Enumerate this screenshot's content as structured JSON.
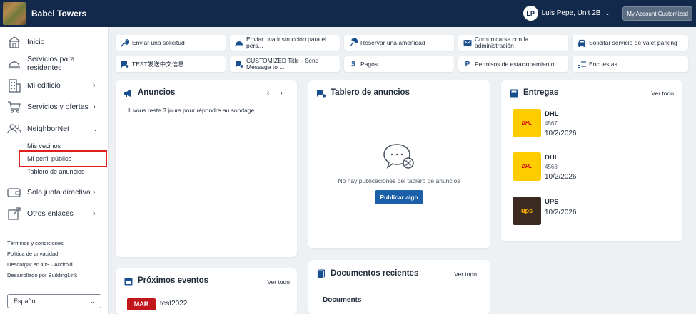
{
  "header": {
    "building_name": "Babel Towers",
    "user_initials": "LP",
    "user_name": "Luis Pepe, Unit 2B",
    "account_button": "My Account Customized"
  },
  "sidebar": {
    "items": [
      {
        "label": "Inicio",
        "icon": "home-icon"
      },
      {
        "label": "Servicios para residentes",
        "icon": "concierge-bell-icon"
      },
      {
        "label": "Mi edificio",
        "icon": "building-icon"
      },
      {
        "label": "Servicios y ofertas",
        "icon": "shopping-cart-icon"
      },
      {
        "label": "NeighborNet",
        "icon": "users-icon"
      },
      {
        "label": "Solo junta directiva",
        "icon": "wallet-icon"
      },
      {
        "label": "Otros enlaces",
        "icon": "external-link-icon"
      }
    ],
    "sub_items": [
      "Mis vecinos",
      "Mi perfil público",
      "Tablero de anuncios"
    ],
    "footer_links": [
      "Términos y condiciones",
      "Política de privacidad",
      "Descargar en iOS · Android",
      "Desarrollado por BuildingLink"
    ],
    "language": "Español"
  },
  "quick_actions": [
    {
      "label": "Enviar una solicitud",
      "icon": "wrench-icon"
    },
    {
      "label": "Enviar una instrucción para el pers...",
      "icon": "concierge-bell-icon"
    },
    {
      "label": "Reservar una amenidad",
      "icon": "amenity-icon"
    },
    {
      "label": "Comunicarse con la administración",
      "icon": "envelope-icon"
    },
    {
      "label": "Solicitar servicio de valet parking",
      "icon": "car-icon"
    },
    {
      "label": "TEST发送中文信息",
      "icon": "chat-add-icon"
    },
    {
      "label": "CUSTOMIZED Title - Send Message to ...",
      "icon": "chat-add-icon"
    },
    {
      "label": "Pagos",
      "icon": "dollar-icon"
    },
    {
      "label": "Permisos de estacionamiento",
      "icon": "parking-icon"
    },
    {
      "label": "Encuestas",
      "icon": "list-icon"
    }
  ],
  "announcements": {
    "title": "Anuncios",
    "text": "Il vous reste 3 jours pour répondre au sondage"
  },
  "bulletin": {
    "title": "Tablero de anuncios",
    "empty_text": "No hay publicaciones del tablero de anuncios",
    "post_button": "Publicar algo"
  },
  "deliveries": {
    "title": "Entregas",
    "see_all": "Ver todo",
    "items": [
      {
        "carrier": "DHL",
        "number": "4567",
        "date": "10/2/2026",
        "logo_text": "DHL"
      },
      {
        "carrier": "DHL",
        "number": "4568",
        "date": "10/2/2026",
        "logo_text": "DHL"
      },
      {
        "carrier": "UPS",
        "number": "",
        "date": "10/2/2026",
        "logo_text": "ups"
      }
    ]
  },
  "events": {
    "title": "Próximos eventos",
    "see_all": "Ver todo",
    "month": "MAR",
    "event_name": "test2022"
  },
  "documents": {
    "title": "Documentos recientes",
    "see_all": "Ver todo",
    "folder": "Documents"
  }
}
